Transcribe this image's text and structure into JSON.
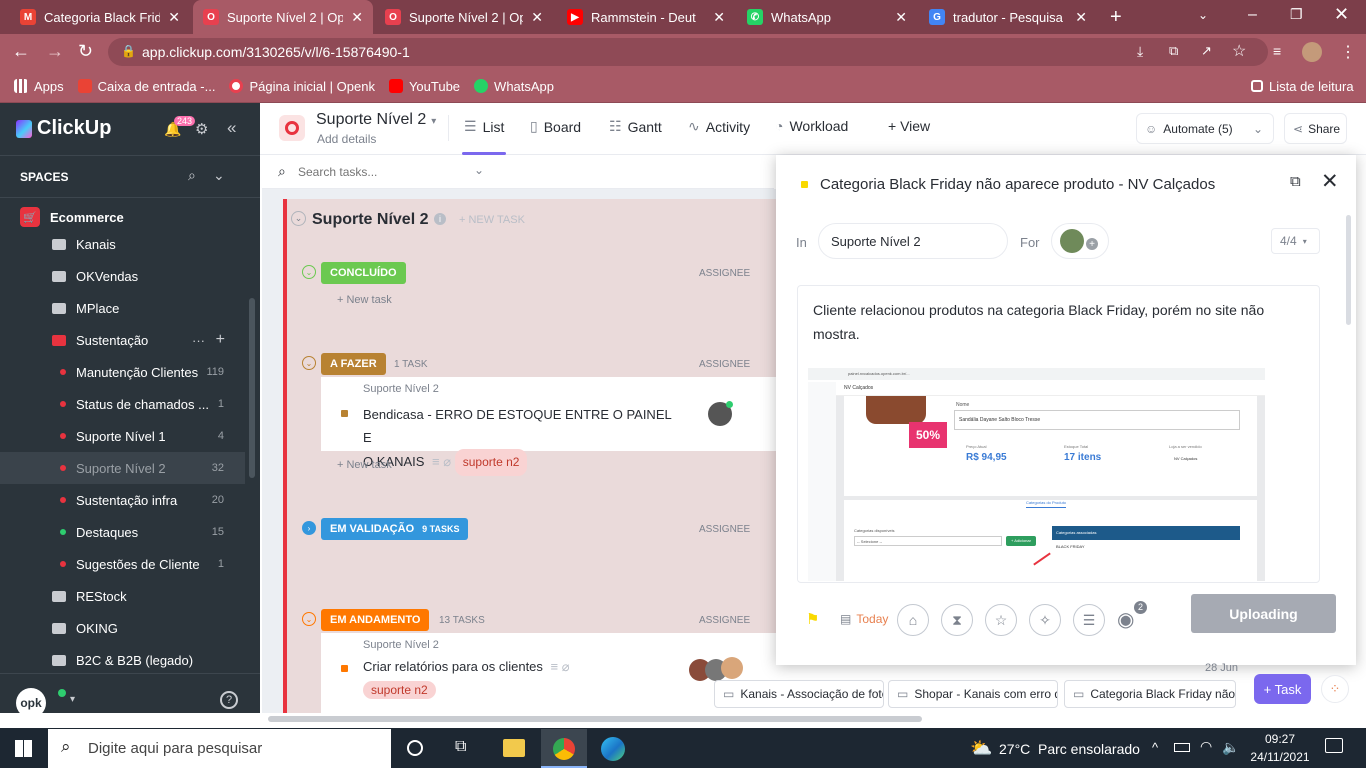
{
  "browser": {
    "tabs": [
      {
        "title": "Categoria Black Friday",
        "icon": "gmail-icon",
        "color": "#ea4335",
        "glyph": "M"
      },
      {
        "title": "Suporte Nível 2 | Oper",
        "icon": "openk-icon",
        "color": "#e8404f",
        "glyph": "O"
      },
      {
        "title": "Suporte Nível 2 | Oper",
        "icon": "openk-icon",
        "color": "#e8404f",
        "glyph": "O"
      },
      {
        "title": "Rammstein - Deut",
        "icon": "youtube-icon",
        "color": "#ff0000",
        "glyph": "▶"
      },
      {
        "title": "WhatsApp",
        "icon": "whatsapp-icon",
        "color": "#25d366",
        "glyph": "✆"
      },
      {
        "title": "tradutor - Pesquisa Go",
        "icon": "google-icon",
        "color": "#4285f4",
        "glyph": "G"
      }
    ],
    "url": "app.clickup.com/3130265/v/l/6-15876490-1",
    "bookmarks": [
      "Apps",
      "Caixa de entrada -...",
      "Página inicial | Openk",
      "YouTube",
      "WhatsApp"
    ],
    "reading_list": "Lista de leitura"
  },
  "sidebar": {
    "logo": "ClickUp",
    "notif_count": "243",
    "spaces_label": "SPACES",
    "space": "Ecommerce",
    "items": [
      {
        "label": "Kanais",
        "kind": "folder"
      },
      {
        "label": "OKVendas",
        "kind": "folder"
      },
      {
        "label": "MPlace",
        "kind": "folder"
      },
      {
        "label": "Sustentação",
        "kind": "folder-open"
      },
      {
        "label": "Manutenção Clientes",
        "count": "119",
        "dot": "#e8333f"
      },
      {
        "label": "Status de chamados ...",
        "count": "1",
        "dot": "#e8333f"
      },
      {
        "label": "Suporte Nível 1",
        "count": "4",
        "dot": "#e8333f"
      },
      {
        "label": "Suporte Nível 2",
        "count": "32",
        "dot": "#e8333f"
      },
      {
        "label": "Sustentação infra",
        "count": "20",
        "dot": "#e8333f"
      },
      {
        "label": "Destaques",
        "count": "15",
        "dot": "#2ecd6f"
      },
      {
        "label": "Sugestões de Cliente",
        "count": "1",
        "dot": "#e8333f"
      },
      {
        "label": "REStock",
        "kind": "folder"
      },
      {
        "label": "OKING",
        "kind": "folder"
      },
      {
        "label": "B2C & B2B (legado)",
        "kind": "folder"
      }
    ],
    "user": "opk"
  },
  "header": {
    "list_name": "Suporte Nível 2",
    "add_details": "Add details",
    "views": [
      "List",
      "Board",
      "Gantt",
      "Activity",
      "Workload",
      "+ View"
    ],
    "automate": "Automate (5)",
    "share": "Share"
  },
  "search": {
    "placeholder": "Search tasks..."
  },
  "list": {
    "title": "Suporte Nível 2",
    "new_task": "+ NEW TASK",
    "assignee": "ASSIGNEE",
    "new_task_row": "+ New task",
    "groups": [
      {
        "name": "CONCLUÍDO",
        "color": "#6bc950",
        "count": ""
      },
      {
        "name": "A FAZER",
        "color": "#b88232",
        "count": "1 TASK"
      },
      {
        "name": "EM VALIDAÇÃO",
        "color": "#3397dd",
        "count": "9 TASKS"
      },
      {
        "name": "EM ANDAMENTO",
        "color": "#ff7800",
        "count": "13 TASKS"
      }
    ],
    "task1": {
      "parent": "Suporte Nível 2",
      "title_l1": "Bendicasa - ERRO DE ESTOQUE ENTRE O PAINEL E",
      "title_l2": "O KANAIS",
      "tag": "suporte n2"
    },
    "task2": {
      "parent": "Suporte Nível 2",
      "title": "Criar relatórios para os clientes",
      "tag": "suporte n2"
    },
    "date_hint": "28 Jun"
  },
  "modal": {
    "title": "Categoria Black Friday não aparece produto - NV Calçados",
    "in_label": "In",
    "in_value": "Suporte Nível 2",
    "for_label": "For",
    "pager": "4/4",
    "description": "Cliente relacionou produtos na categoria Black Friday, porém no site não mostra.",
    "screenshot": {
      "url": "painel.nvcalcados.openk.com.br/...",
      "brand": "NV Calçados",
      "badge": "50%",
      "field_label": "Nome",
      "product": "Sandália Dayane Salto Bloco Tresse",
      "price_label": "Preço Atual",
      "price": "R$ 94,95",
      "stock_label": "Estoque Total",
      "stock": "17 itens",
      "seller_label": "Loja a ser vendido",
      "seller": "NV Calçados",
      "tab_active": "Categorias do Produto",
      "available_label": "Categorias disponíveis",
      "select_placeholder": "-- Selecione --",
      "add_button": "+ Adicionar",
      "assoc_header": "Categorias associadas",
      "assoc_item": "BLACK FRIDAY"
    },
    "today": "Today",
    "watchers": "2",
    "upload_button": "Uploading"
  },
  "trays": [
    "Kanais - Associação de foto",
    "Shopar - Kanais com erro d",
    "Categoria Black Friday não"
  ],
  "task_button": "+ Task",
  "taskbar": {
    "search_placeholder": "Digite aqui para pesquisar",
    "temp": "27°C",
    "weather": "Parc ensolarado",
    "time": "09:27",
    "date": "24/11/2021"
  }
}
